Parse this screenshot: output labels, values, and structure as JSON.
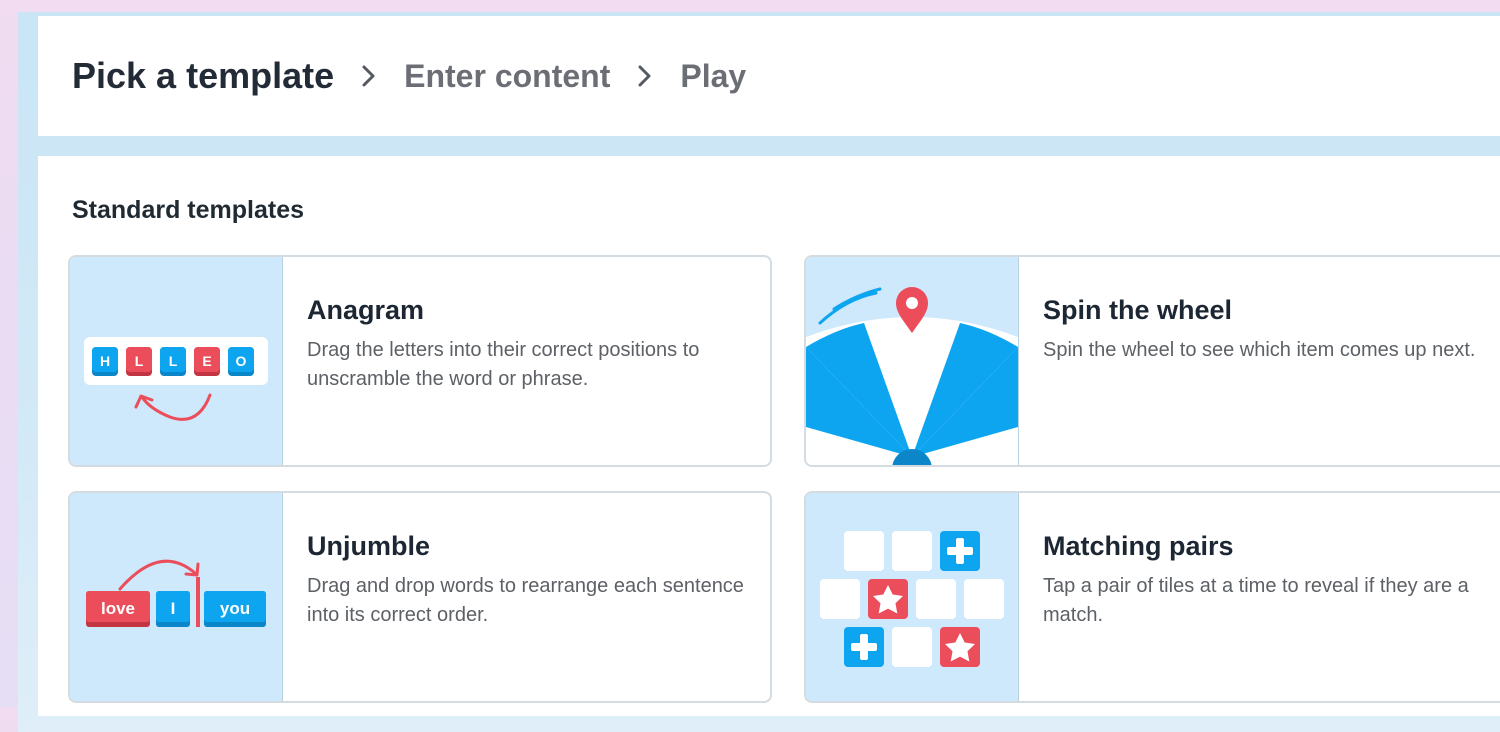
{
  "breadcrumb": {
    "step1": "Pick a template",
    "step2": "Enter content",
    "step3": "Play"
  },
  "section": {
    "title": "Standard templates"
  },
  "templates": [
    {
      "title": "Anagram",
      "description": "Drag the letters into their correct positions to unscramble the word or phrase.",
      "tiles": [
        "H",
        "L",
        "L",
        "E",
        "O"
      ]
    },
    {
      "title": "Spin the wheel",
      "description": "Spin the wheel to see which item comes up next."
    },
    {
      "title": "Unjumble",
      "description": "Drag and drop words to rearrange each sentence into its correct order.",
      "words": [
        "love",
        "I",
        "you"
      ]
    },
    {
      "title": "Matching pairs",
      "description": "Tap a pair of tiles at a time to reveal if they are a match."
    }
  ],
  "colors": {
    "blue": "#0ea5f0",
    "red": "#ec4d5b",
    "thumb_bg": "#cde9fb"
  }
}
